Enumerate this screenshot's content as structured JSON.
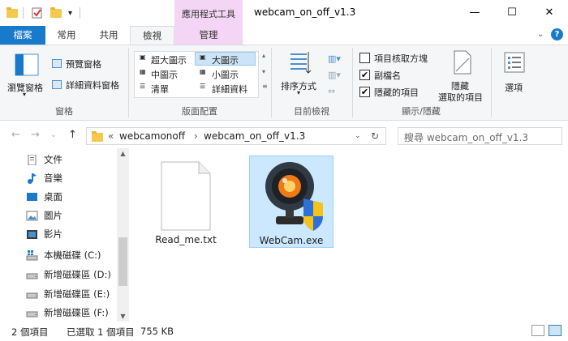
{
  "window": {
    "title": "webcam_on_off_v1.3",
    "context_tab": "應用程式工具",
    "minimize": "—",
    "maximize": "☐",
    "close": "✕"
  },
  "tabs": {
    "file": "檔案",
    "home": "常用",
    "share": "共用",
    "view": "檢視",
    "manage": "管理"
  },
  "ribbon": {
    "panes": {
      "nav_pane": "瀏覽窗格",
      "preview_pane": "預覽窗格",
      "details_pane": "詳細資料窗格",
      "group_label": "窗格"
    },
    "layout": {
      "extra_large": "超大圖示",
      "large": "大圖示",
      "medium": "中圖示",
      "small": "小圖示",
      "list": "清單",
      "details": "詳細資料",
      "group_label": "版面配置"
    },
    "current_view": {
      "sort_by": "排序方式",
      "group_label": "目前檢視"
    },
    "show_hide": {
      "item_checkboxes": "項目核取方塊",
      "item_checkboxes_checked": "",
      "file_extensions": "副檔名",
      "file_extensions_checked": "✔",
      "hidden_items": "隱藏的項目",
      "hidden_items_checked": "✔",
      "hide_selected_1": "隱藏",
      "hide_selected_2": "選取的項目",
      "group_label": "顯示/隱藏"
    },
    "options": "選項"
  },
  "address": {
    "crumb_sep": "«",
    "crumb_1": "webcamonoff",
    "arrow": "›",
    "crumb_2": "webcam_on_off_v1.3",
    "search_placeholder": "搜尋 webcam_on_off_v1.3"
  },
  "nav_pane": {
    "items": [
      {
        "label": "文件"
      },
      {
        "label": "音樂"
      },
      {
        "label": "桌面"
      },
      {
        "label": "圖片"
      },
      {
        "label": "影片"
      },
      {
        "label": "本機磁碟 (C:)"
      },
      {
        "label": "新增磁碟區 (D:)"
      },
      {
        "label": "新增磁碟區 (E:)"
      },
      {
        "label": "新增磁碟區 (F:)"
      }
    ]
  },
  "files": [
    {
      "name": "Read_me.txt"
    },
    {
      "name": "WebCam.exe"
    }
  ],
  "status": {
    "item_count": "2 個項目",
    "selected": "已選取 1 個項目",
    "size": "755 KB"
  },
  "colors": {
    "file_tab": "#1979ca",
    "context": "#f4d5f5",
    "selection": "#cce8ff"
  }
}
